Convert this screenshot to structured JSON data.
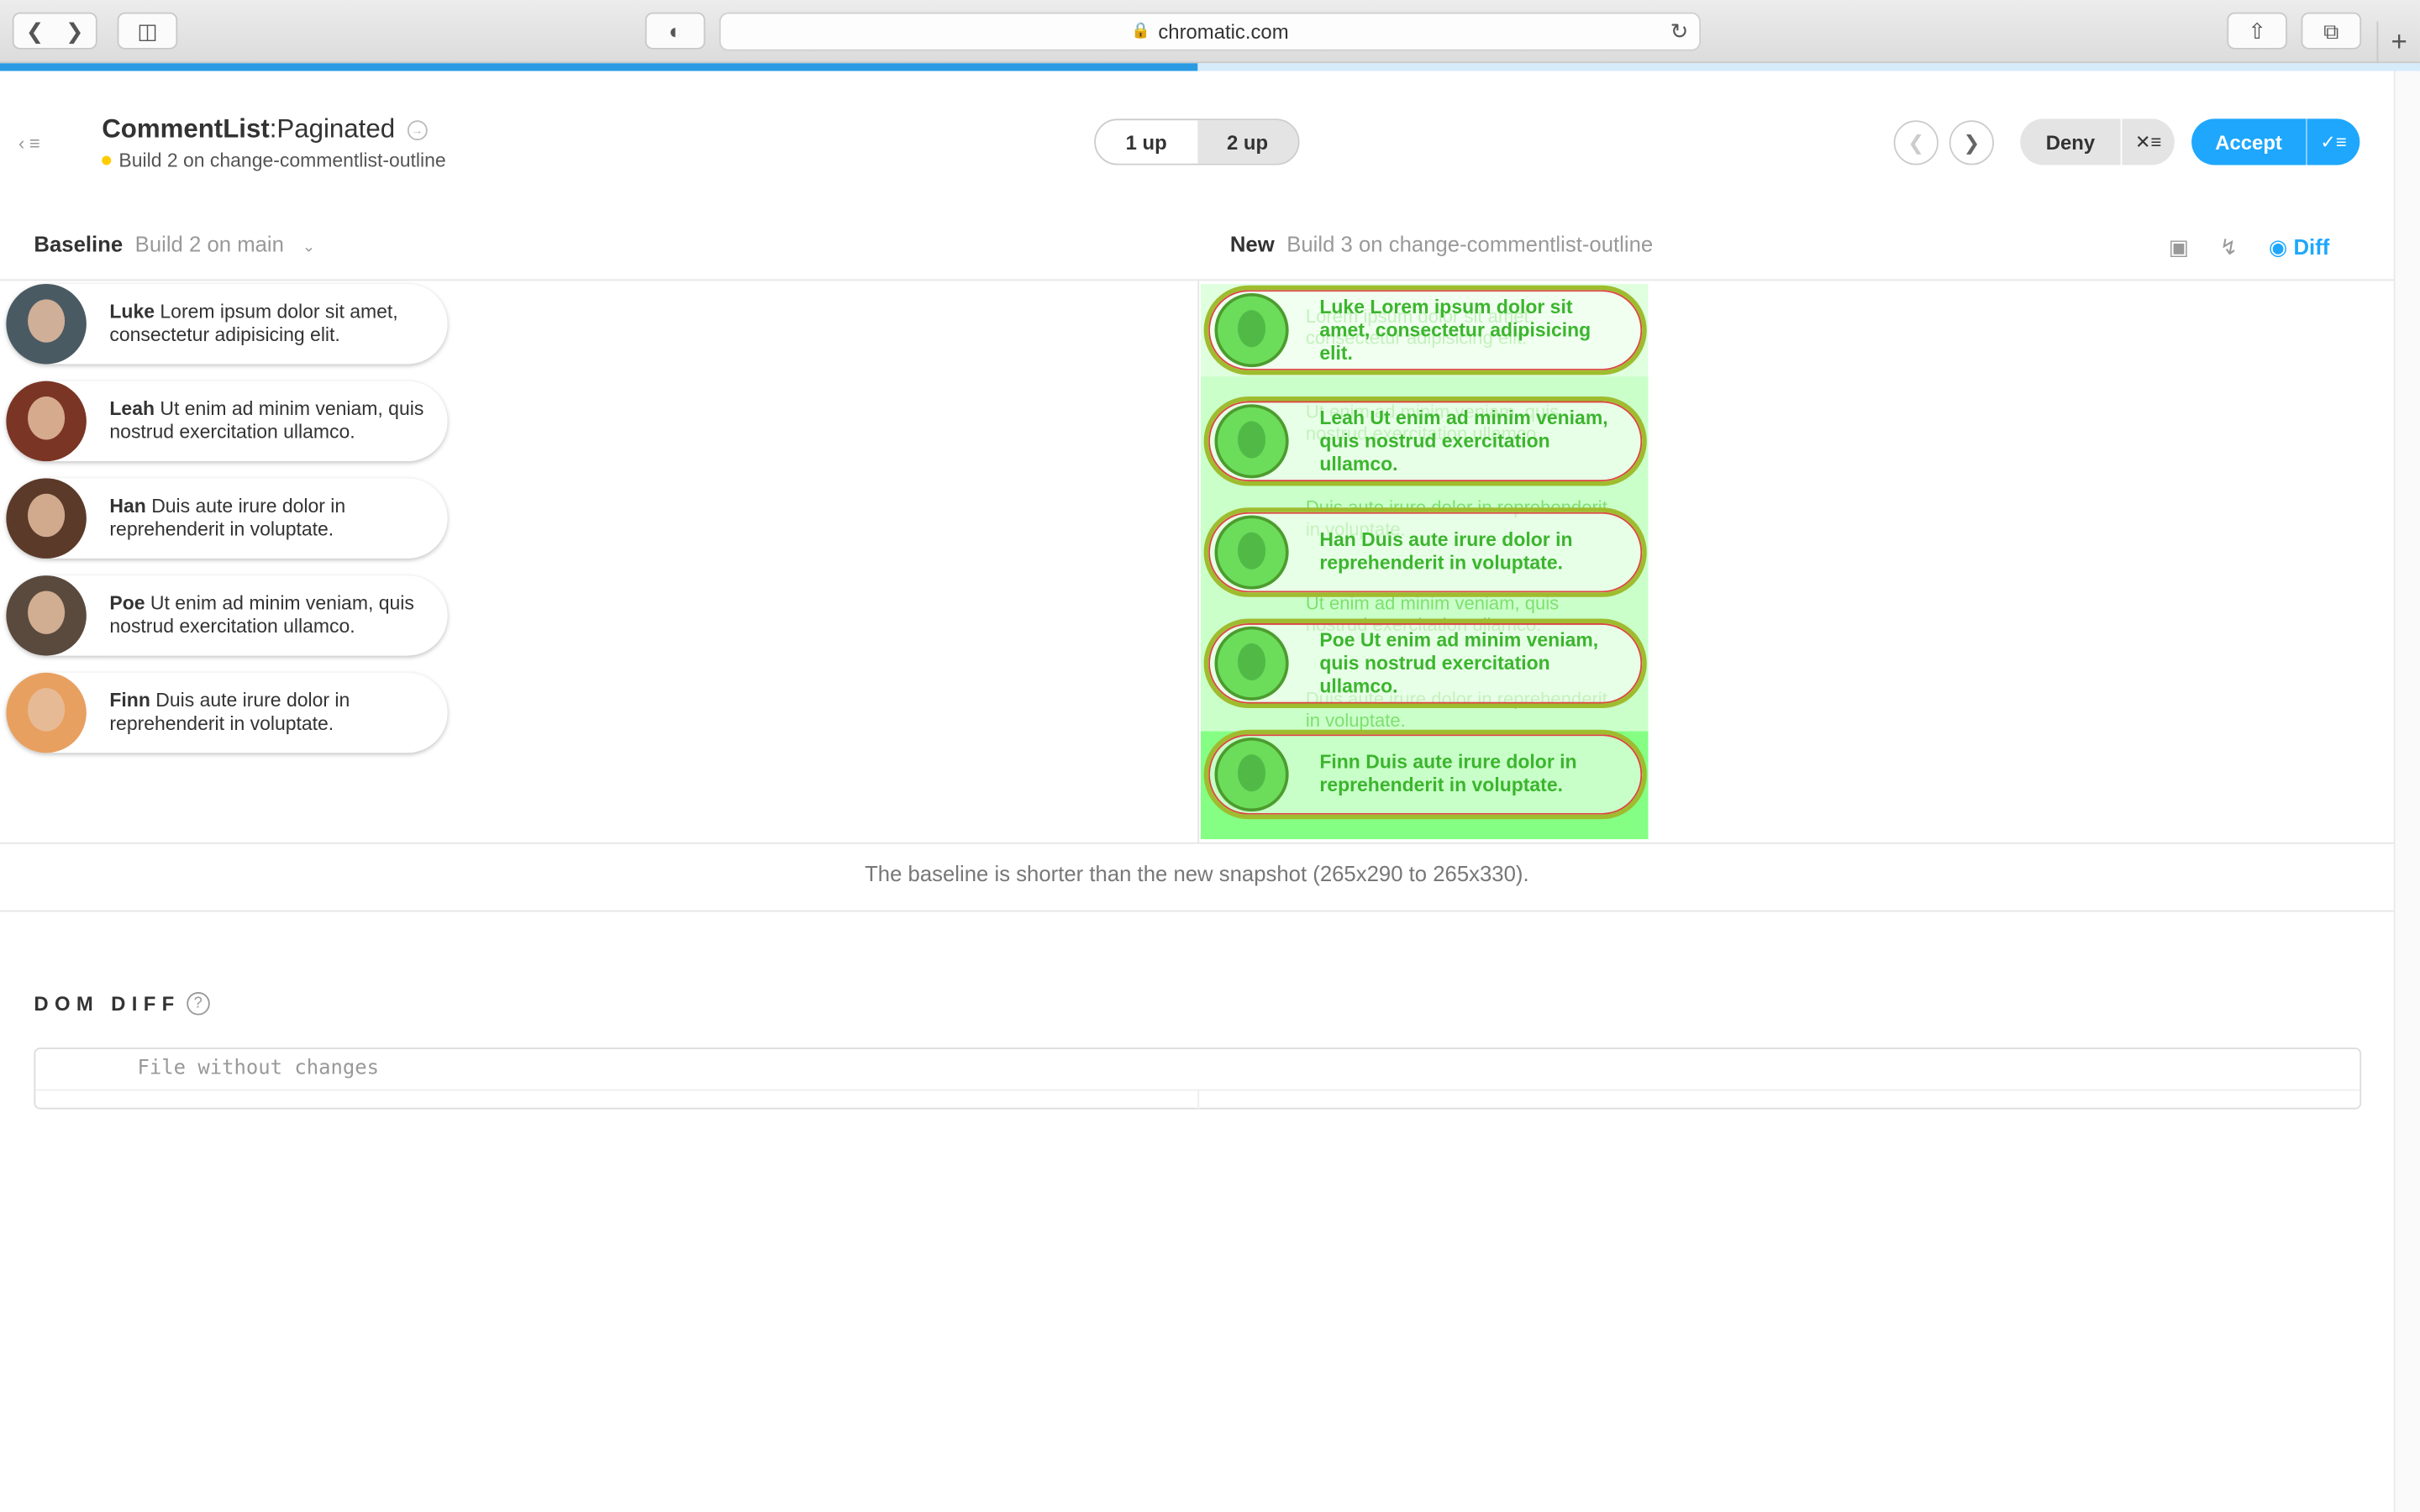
{
  "browser": {
    "url": "chromatic.com",
    "new_tab": "+"
  },
  "header": {
    "component": "CommentList",
    "separator": ":",
    "story": "Paginated",
    "build_status": "Build 2 on change-commentlist-outline",
    "view_modes": [
      "1 up",
      "2 up"
    ],
    "selected_view": "2 up",
    "deny_label": "Deny",
    "accept_label": "Accept",
    "accent_color": "#1ea7fd"
  },
  "baseline": {
    "label": "Baseline",
    "build": "Build 2 on main",
    "comments": [
      {
        "name": "Luke",
        "text": "Lorem ipsum dolor sit amet, consectetur adipisicing elit."
      },
      {
        "name": "Leah",
        "text": "Ut enim ad minim veniam, quis nostrud exercitation ullamco."
      },
      {
        "name": "Han",
        "text": "Duis aute irure dolor in reprehenderit in voluptate."
      },
      {
        "name": "Poe",
        "text": "Ut enim ad minim veniam, quis nostrud exercitation ullamco."
      },
      {
        "name": "Finn",
        "text": "Duis aute irure dolor in reprehenderit in voluptate."
      }
    ]
  },
  "new": {
    "label": "New",
    "build": "Build 3 on change-commentlist-outline",
    "diff_label": "Diff",
    "comments": [
      {
        "name": "Luke",
        "text": "Lorem ipsum dolor sit amet, consectetur adipisicing elit."
      },
      {
        "name": "Leah",
        "text": "Ut enim ad minim veniam, quis nostrud exercitation ullamco."
      },
      {
        "name": "Han",
        "text": "Duis aute irure dolor in reprehenderit in voluptate."
      },
      {
        "name": "Poe",
        "text": "Ut enim ad minim veniam, quis nostrud exercitation ullamco."
      },
      {
        "name": "Finn",
        "text": "Duis aute irure dolor in reprehenderit in voluptate."
      }
    ]
  },
  "size_note": "The baseline is shorter than the new snapshot (265x290 to 265x330).",
  "dom_diff": {
    "title": "DOM DIFF",
    "message": "File without changes"
  }
}
